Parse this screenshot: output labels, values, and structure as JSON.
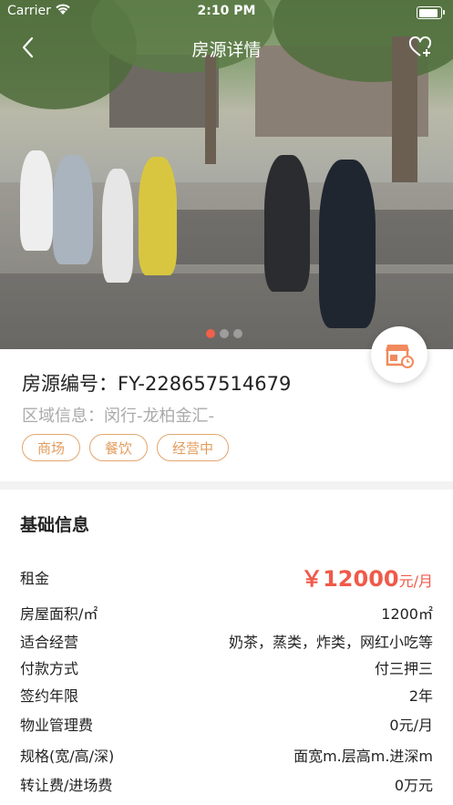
{
  "status_bar": {
    "carrier": "Carrier",
    "time": "2:10 PM"
  },
  "nav": {
    "title": "房源详情"
  },
  "gallery": {
    "page_count": 3,
    "active_index": 0
  },
  "listing": {
    "code_label": "房源编号：FY-228657514679",
    "area_label": "区域信息：闵行-龙柏金汇-",
    "tags": [
      "商场",
      "餐饮",
      "经营中"
    ]
  },
  "basic_info": {
    "title": "基础信息",
    "rent_label": "租金",
    "rent_currency": "￥",
    "rent_value": "12000",
    "rent_unit": "元/月",
    "rows": [
      {
        "label": "房屋面积/㎡",
        "value": "1200㎡"
      },
      {
        "label": "适合经营",
        "value": "奶茶，蒸类，炸类，网红小吃等"
      },
      {
        "label": "付款方式",
        "value": "付三押三"
      },
      {
        "label": "签约年限",
        "value": "2年"
      },
      {
        "label": "物业管理费",
        "value": "0元/月"
      },
      {
        "label": "规格(宽/高/深)",
        "value": "面宽m.层高m.进深m"
      },
      {
        "label": "转让费/进场费",
        "value": "0万元"
      }
    ]
  },
  "colors": {
    "accent": "#ef5a4a",
    "tag": "#e39c5c"
  }
}
